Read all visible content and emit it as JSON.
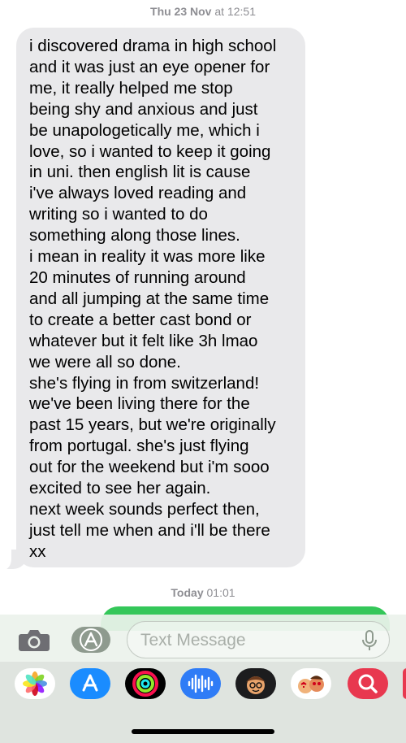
{
  "conversation": {
    "first_timestamp_day": "Thu 23 Nov",
    "first_timestamp_time": "at 12:51",
    "message_lines": [
      "i discovered drama in high school",
      "and it was just an eye opener for",
      "me, it really helped me stop",
      "being shy and anxious and just",
      "be unapologetically me, which i",
      "love, so i wanted to keep it going",
      "in uni. then english lit is cause",
      "i've always loved reading and",
      "writing so i wanted to do",
      "something along those lines.",
      "i mean in reality it was more like",
      "20 minutes of running around",
      "and all jumping at the same time",
      "to create a better cast bond or",
      "whatever but it felt like 3h lmao",
      "we were all so done.",
      "she's flying in from switzerland!",
      "we've been living there for the",
      "past 15 years, but we're originally",
      "from portugal. she's just flying",
      "out for the weekend but i'm sooo",
      "excited to see her again.",
      "next week sounds perfect then,",
      "just tell me when and i'll be there",
      "xx"
    ],
    "second_timestamp_day": "Today",
    "second_timestamp_time": "01:01"
  },
  "composer": {
    "placeholder": "Text Message",
    "camera_icon": "camera-icon",
    "apps_icon": "app-store-icon",
    "mic_icon": "microphone-icon"
  },
  "app_tray": {
    "apps": [
      {
        "name": "photos-app-icon",
        "bg": "#ffffff"
      },
      {
        "name": "app-store-app-icon",
        "bg": "#1a8cff"
      },
      {
        "name": "fitness-app-icon",
        "bg": "#000000"
      },
      {
        "name": "audio-message-app-icon",
        "bg": "#2f7cf6"
      },
      {
        "name": "memoji-app-icon",
        "bg": "#1c1c1e"
      },
      {
        "name": "memoji-stickers-app-icon",
        "bg": "#ffffff"
      },
      {
        "name": "image-search-app-icon",
        "bg": "#e8384f"
      }
    ]
  },
  "colors": {
    "incoming_bubble": "#e9e9eb",
    "outgoing_bubble": "#34c759",
    "timestamp": "#8e8e93"
  }
}
